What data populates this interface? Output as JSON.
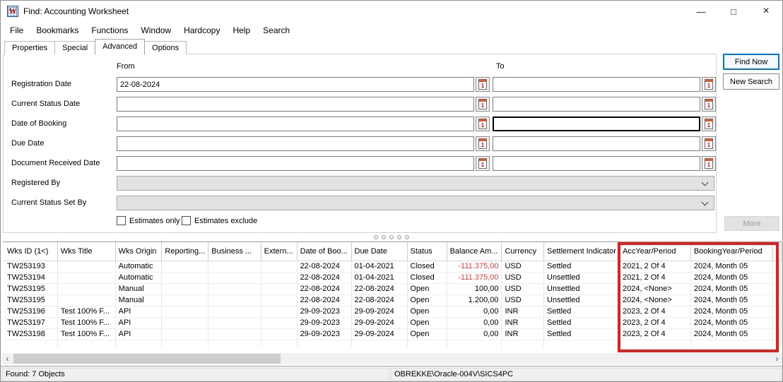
{
  "window": {
    "title": "Find: Accounting Worksheet"
  },
  "icons": {
    "app_letter": "W",
    "minimize": "—",
    "maximize": "□",
    "close": "×",
    "calendar_day": "1",
    "scroll_left": "‹",
    "scroll_right": "›"
  },
  "menu": {
    "items": [
      "File",
      "Bookmarks",
      "Functions",
      "Window",
      "Hardcopy",
      "Help",
      "Search"
    ]
  },
  "tabs": [
    {
      "label": "Properties",
      "active": false
    },
    {
      "label": "Special",
      "active": false
    },
    {
      "label": "Advanced",
      "active": true
    },
    {
      "label": "Options",
      "active": false
    }
  ],
  "form": {
    "from_label": "From",
    "to_label": "To",
    "date_fields": [
      {
        "label": "Registration Date",
        "from_value": "22-08-2024",
        "to_value": "",
        "to_focused": false
      },
      {
        "label": "Current Status Date",
        "from_value": "",
        "to_value": "",
        "to_focused": false
      },
      {
        "label": "Date of Booking",
        "from_value": "",
        "to_value": "",
        "to_focused": true
      },
      {
        "label": "Due Date",
        "from_value": "",
        "to_value": "",
        "to_focused": false
      },
      {
        "label": "Document Received Date",
        "from_value": "",
        "to_value": "",
        "to_focused": false
      }
    ],
    "dropdown_fields": [
      {
        "label": "Registered By",
        "value": ""
      },
      {
        "label": "Current Status Set By",
        "value": ""
      }
    ],
    "checkboxes": [
      {
        "label": "Estimates only",
        "checked": false
      },
      {
        "label": "Estimates exclude",
        "checked": false
      }
    ]
  },
  "buttons": {
    "find_now": "Find Now",
    "new_search": "New Search",
    "more": "More"
  },
  "table": {
    "columns": [
      "Wks ID (1<)",
      "Wks Title",
      "Wks Origin",
      "Reporting...",
      "Business ...",
      "Extern...",
      "Date of Boo...",
      "Due Date",
      "Status",
      "Balance Am...",
      "Currency",
      "Settlement Indicator",
      "AccYear/Period",
      "BookingYear/Period"
    ],
    "rows": [
      [
        "TW253193",
        "",
        "Automatic",
        "",
        "",
        "",
        "22-08-2024",
        "01-04-2021",
        "Closed",
        "-111.375,00",
        "USD",
        "Settled",
        "2021, 2 Of 4",
        "2024, Month 05"
      ],
      [
        "TW253194",
        "",
        "Automatic",
        "",
        "",
        "",
        "22-08-2024",
        "01-04-2021",
        "Closed",
        "-111.375,00",
        "USD",
        "Unsettled",
        "2021, 2 Of 4",
        "2024, Month 05"
      ],
      [
        "TW253195",
        "",
        "Manual",
        "",
        "",
        "",
        "22-08-2024",
        "22-08-2024",
        "Open",
        "100,00",
        "USD",
        "Unsettled",
        "2024, <None>",
        "2024, Month 05"
      ],
      [
        "TW253195",
        "",
        "Manual",
        "",
        "",
        "",
        "22-08-2024",
        "22-08-2024",
        "Open",
        "1.200,00",
        "USD",
        "Unsettled",
        "2024, <None>",
        "2024, Month 05"
      ],
      [
        "TW253196",
        "Test 100% F...",
        "API",
        "",
        "",
        "",
        "29-09-2023",
        "29-09-2024",
        "Open",
        "0,00",
        "INR",
        "Settled",
        "2023, 2 Of 4",
        "2024, Month 05"
      ],
      [
        "TW253197",
        "Test 100% F...",
        "API",
        "",
        "",
        "",
        "29-09-2023",
        "29-09-2024",
        "Open",
        "0,00",
        "INR",
        "Settled",
        "2023, 2 Of 4",
        "2024, Month 05"
      ],
      [
        "TW253198",
        "Test 100% F...",
        "API",
        "",
        "",
        "",
        "29-09-2023",
        "29-09-2024",
        "Open",
        "0,00",
        "INR",
        "Settled",
        "2023, 2 Of 4",
        "2024, Month 05"
      ]
    ],
    "negative_amount_color": "#fb3b3b",
    "highlight_color": "#e0201f",
    "highlighted_columns": [
      "AccYear/Period",
      "BookingYear/Period"
    ]
  },
  "statusbar": {
    "found": "Found: 7 Objects",
    "host": "OBREKKE\\Oracle-004V\\SICS4PC"
  }
}
